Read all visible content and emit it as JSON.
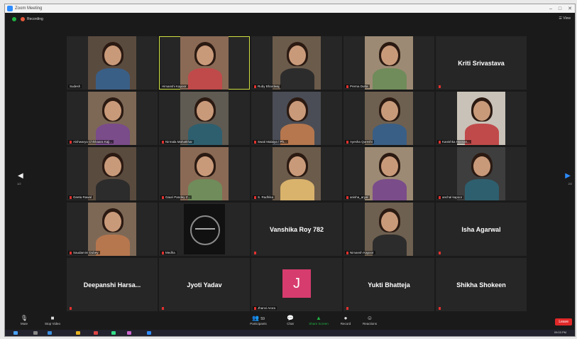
{
  "window": {
    "title": "Zoom Meeting",
    "controls": [
      "–",
      "□",
      "✕"
    ]
  },
  "meeting": {
    "recording_label": "Recording",
    "view_label": "View"
  },
  "navigation": {
    "prev_page": "1/2",
    "next_page": "2/2"
  },
  "participants": [
    {
      "name": "Sudesh",
      "video": true,
      "muted": false
    },
    {
      "name": "Himanshi Kapoor",
      "video": true,
      "muted": false,
      "active": true
    },
    {
      "name": "Ruby Bhardwaj",
      "video": true,
      "muted": true
    },
    {
      "name": "Prerna Dutta",
      "video": true,
      "muted": true
    },
    {
      "name": "Kriti Srivastava",
      "video": false,
      "muted": true
    },
    {
      "name": "Aishwarya Chhikaara Kaji...",
      "video": true,
      "muted": true
    },
    {
      "name": "Nirmala Mahatkhar",
      "video": true,
      "muted": true
    },
    {
      "name": "Swati Malaiya / Ph...",
      "video": true,
      "muted": true
    },
    {
      "name": "Ayesha Qureshi",
      "video": true,
      "muted": true
    },
    {
      "name": "Kanishka Hassan...",
      "video": true,
      "muted": true
    },
    {
      "name": "Geeta Rawal",
      "video": true,
      "muted": true
    },
    {
      "name": "Gauri Pandey Z...",
      "video": true,
      "muted": true
    },
    {
      "name": "S. Radhika",
      "video": true,
      "muted": true
    },
    {
      "name": "anisha_aryal",
      "video": true,
      "muted": true
    },
    {
      "name": "anchal kapoor",
      "video": true,
      "muted": true
    },
    {
      "name": "Saudamini Dubey",
      "video": true,
      "muted": true
    },
    {
      "name": "Medha",
      "video": true,
      "muted": true,
      "logo": true
    },
    {
      "name": "Vanshika Roy 782",
      "video": false,
      "muted": true
    },
    {
      "name": "Nimansh Kapoor",
      "video": true,
      "muted": true
    },
    {
      "name": "Isha Agarwal",
      "video": false,
      "muted": true
    },
    {
      "name": "Deepanshi Harsa...",
      "video": false,
      "muted": true
    },
    {
      "name": "Jyoti Yadav",
      "video": false,
      "muted": true
    },
    {
      "name": "Jhanvi Arora",
      "video": false,
      "muted": true,
      "initial": "J"
    },
    {
      "name": "Yukti Bhatteja",
      "video": false,
      "muted": true
    },
    {
      "name": "Shikha Shokeen",
      "video": false,
      "muted": true
    }
  ],
  "toolbar": {
    "mute": "Mute",
    "stop_video": "Stop Video",
    "participants": "Participants",
    "participants_count": "59",
    "chat": "Chat",
    "share_screen": "Share Screen",
    "record": "Record",
    "reactions": "Reactions",
    "leave": "Leave"
  },
  "taskbar": {
    "time": "09:03 PM"
  },
  "colors": {
    "accent": "#2d8cff",
    "active_speaker": "#cfe03e",
    "leave": "#e02828",
    "share": "#1fb141"
  }
}
